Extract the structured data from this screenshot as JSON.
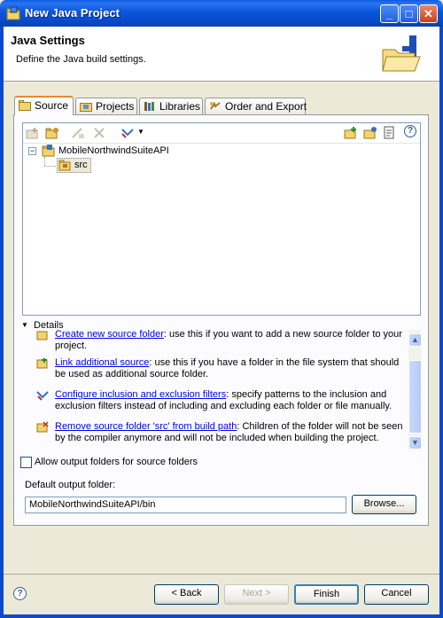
{
  "window": {
    "title": "New Java Project"
  },
  "header": {
    "title": "Java Settings",
    "description": "Define the Java build settings."
  },
  "tabs": [
    {
      "label": "Source"
    },
    {
      "label": "Projects"
    },
    {
      "label": "Libraries"
    },
    {
      "label": "Order and Export"
    }
  ],
  "tree": {
    "project": "MobileNorthwindSuiteAPI",
    "folder": "src"
  },
  "details": {
    "label": "Details",
    "items": [
      {
        "link": "Create new source folder",
        "text": ": use this if you want to add a new source folder to your project."
      },
      {
        "link": "Link additional source",
        "text": ": use this if you have a folder in the file system that should be used as additional source folder."
      },
      {
        "link": "Configure inclusion and exclusion filters",
        "text": ": specify patterns to the inclusion and exclusion filters instead of including and excluding each folder or file manually."
      },
      {
        "link": "Remove source folder 'src' from build path",
        "text": ": Children of the folder will not be seen by the compiler anymore and will not be included when building the project."
      }
    ]
  },
  "allow_output": {
    "label": "Allow output folders for source folders",
    "checked": false
  },
  "output": {
    "label": "Default output folder:",
    "value": "MobileNorthwindSuiteAPI/bin",
    "browse_label": "Browse..."
  },
  "buttons": {
    "back": "< Back",
    "next": "Next >",
    "finish": "Finish",
    "cancel": "Cancel"
  },
  "colors": {
    "title_bar": "#0a55da",
    "link": "#0000ee",
    "tab_highlight": "#e68b2c"
  }
}
